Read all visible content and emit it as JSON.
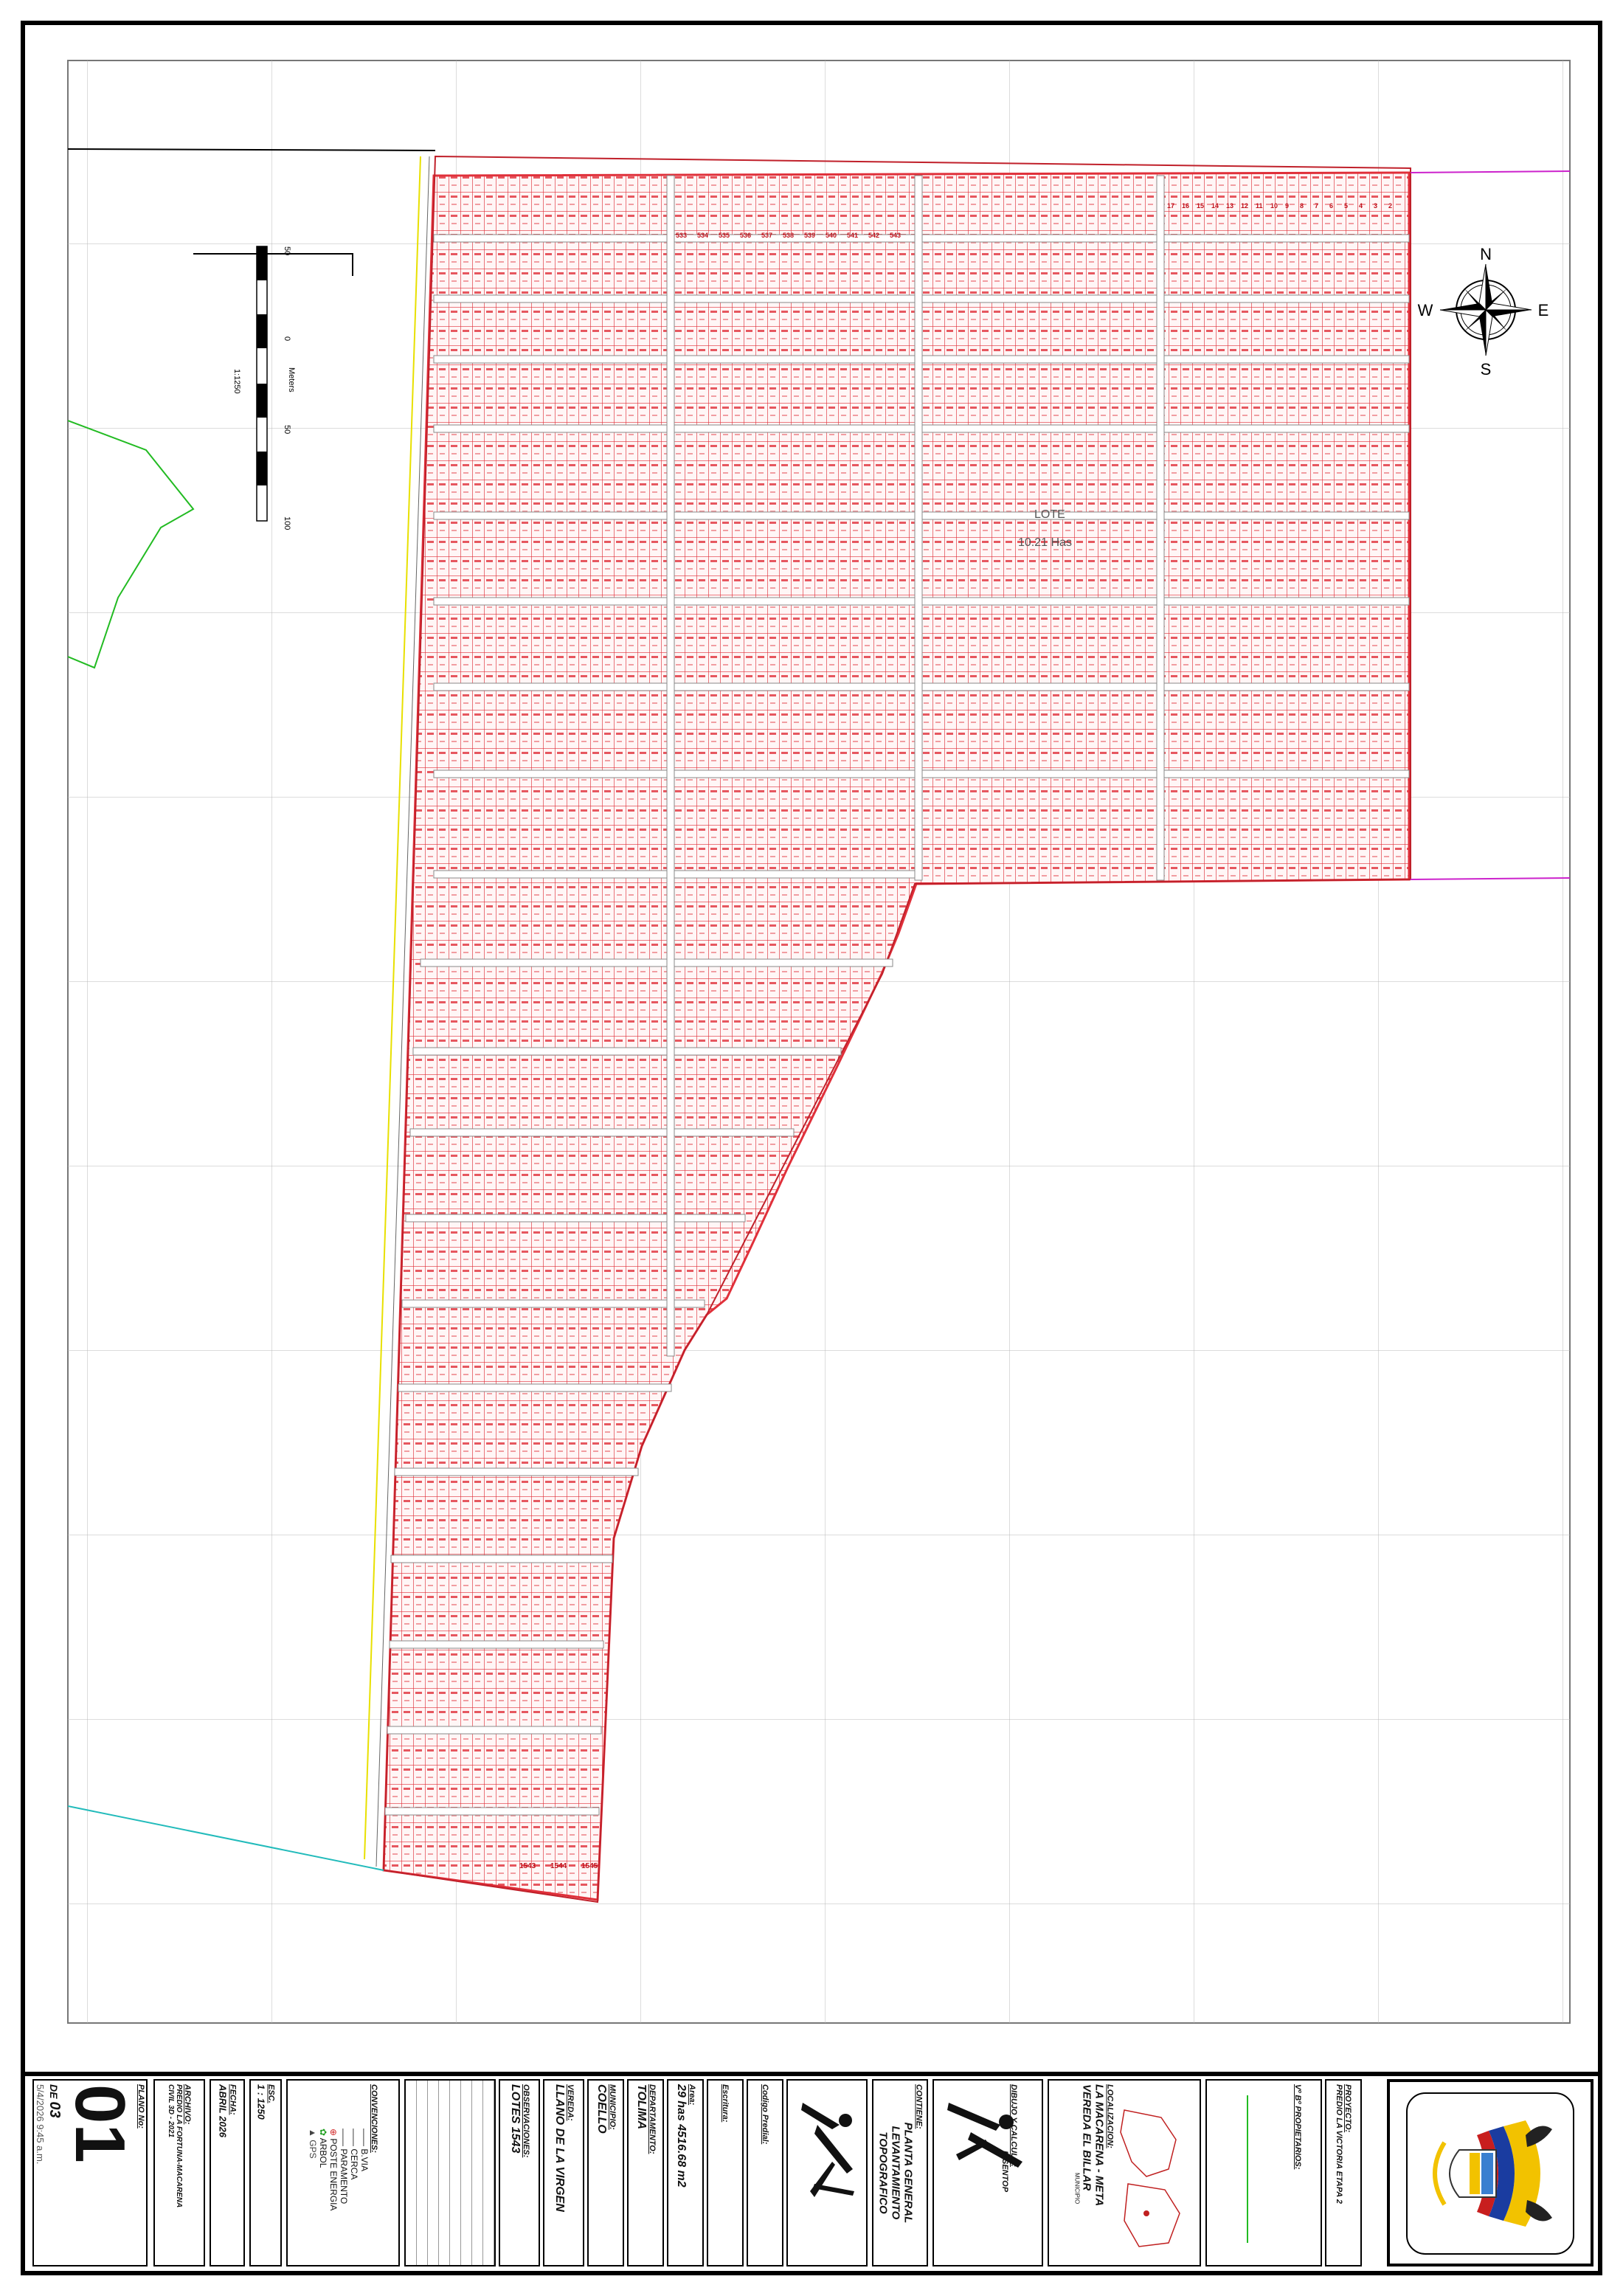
{
  "compass": {
    "north": "N",
    "south": "S",
    "east": "E",
    "west": "W"
  },
  "scale_bar": {
    "unit_label": "Meters",
    "ratio_label": "1:1250",
    "ticks": [
      "50",
      "0",
      "50",
      "100"
    ]
  },
  "lot_label": {
    "line1": "LOTE",
    "line2": "10.21 Has"
  },
  "lot_numbers": {
    "top_left": [
      "533",
      "534",
      "535",
      "536",
      "537",
      "538",
      "539",
      "540",
      "541",
      "542",
      "543"
    ],
    "top_right": [
      "17",
      "16",
      "15",
      "14",
      "13",
      "12",
      "11",
      "10",
      "9",
      "8",
      "7",
      "6",
      "5",
      "4",
      "3",
      "2"
    ],
    "bottom": [
      "1543",
      "1544",
      "1545"
    ]
  },
  "title_block": {
    "plano": {
      "label": "PLANO No:",
      "value": "01",
      "de_label": "DE",
      "de_value": "03",
      "timestamp": "5/4/2026 9:45 a.m."
    },
    "archivo": {
      "label": "ARCHIVO:",
      "value": "PREDIO LA FORTUNA-MACARENA",
      "value2": "CIVIL 3D - 2021"
    },
    "fecha": {
      "label": "FECHA:",
      "value": "ABRIL 2026"
    },
    "escala": {
      "label": "ESC.",
      "value": "1 : 1250"
    },
    "convenciones": {
      "label": "CONVENCIONES:",
      "items": [
        "B.VIA",
        "CERCA",
        "PARAMENTO",
        "POSTE ENERGIA",
        "ARBOL",
        "GPS"
      ]
    },
    "observaciones": {
      "label": "OBSERVACIONES:",
      "value": "LOTES 1543"
    },
    "vereda": {
      "label": "VEREDA:",
      "value": "LLANO DE LA VIRGEN"
    },
    "municipio": {
      "label": "MUNICIPIO:",
      "value": "COELLO"
    },
    "departamento": {
      "label": "DEPARTAMENTO:",
      "value": "TOLIMA"
    },
    "area": {
      "label": "Area:",
      "value": "29 has 4516.68 m2"
    },
    "escritura": {
      "label": "Escritura:"
    },
    "codigo_predial": {
      "label": "Codigo Predial:"
    },
    "contiene": {
      "label": "CONTIENE:",
      "line1": "PLANTA GENERAL",
      "line2": "LEVANTAMIENTO",
      "line3": "TOPOGRAFICO"
    },
    "dibujo": {
      "label": "DIBUJO Y CALCULO:",
      "value": "DISENTOP"
    },
    "localizacion": {
      "label": "LOCALIZACION:",
      "line1": "LA MACARENA - META",
      "line2": "VEREDA EL BILLAR",
      "municipio_tag": "MUNICIPIO"
    },
    "propietarios": {
      "label": "Vº Bº PROPIETARIOS:"
    },
    "proyecto": {
      "label": "PROYECTO:",
      "value": "PREDIO LA VICTORIA ETAPA 2"
    }
  },
  "colors": {
    "lot_lines": "#e0303a",
    "grid": "#b0b0b0",
    "boundary_green": "#22bb22",
    "boundary_cyan": "#22bbbb",
    "boundary_magenta": "#cc22cc",
    "road_yellow": "#e8e000"
  }
}
